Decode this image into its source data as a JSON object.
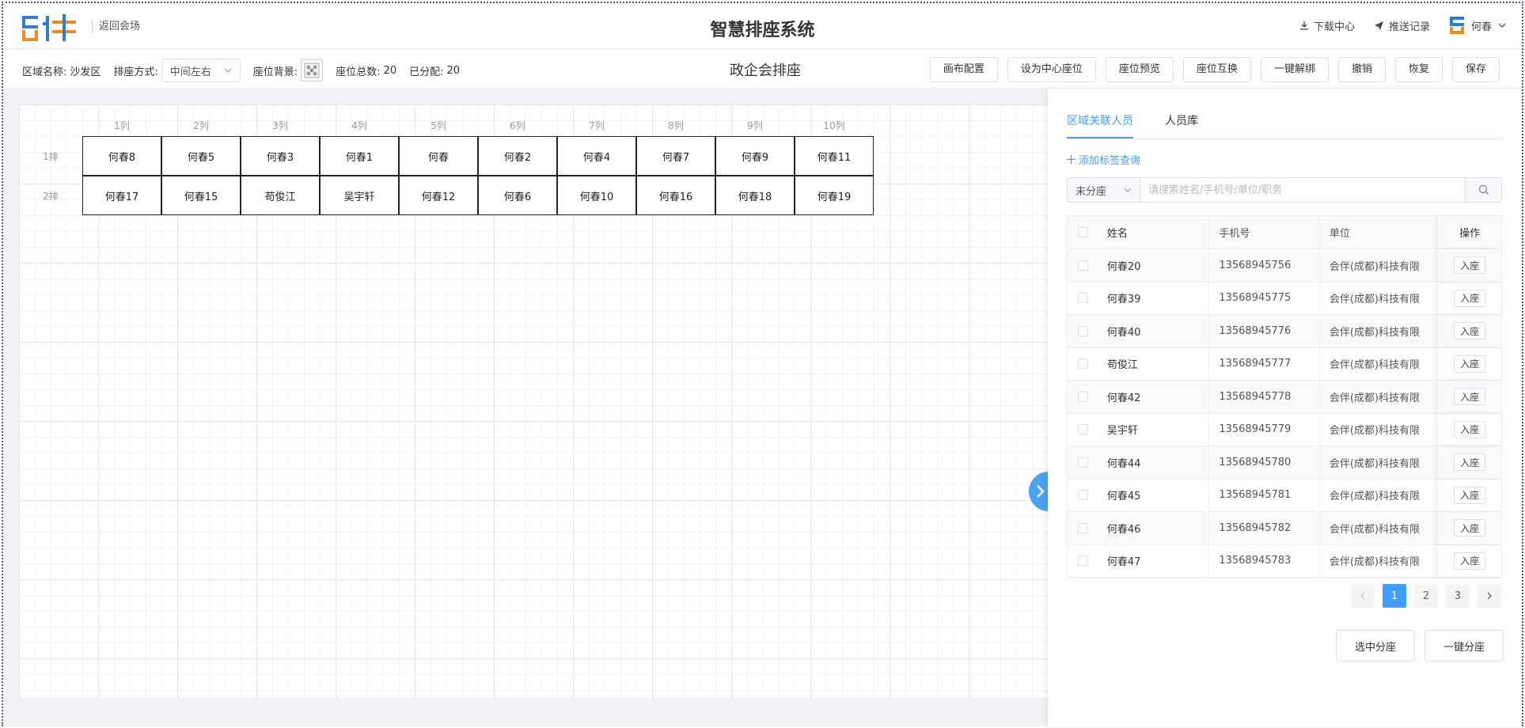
{
  "header": {
    "logo_text": "会伴",
    "back_label": "返回会场",
    "title": "智慧排座系统",
    "download_label": "下载中心",
    "push_label": "推送记录",
    "user_name": "何春"
  },
  "toolbar": {
    "area_label": "区域名称:",
    "area_value": "沙发区",
    "mode_label": "排座方式:",
    "mode_value": "中间左右",
    "bg_label": "座位背景:",
    "total_label": "座位总数:",
    "total_value": "20",
    "assigned_label": "已分配:",
    "assigned_value": "20",
    "center_title": "政企会排座",
    "buttons": [
      "画布配置",
      "设为中心座位",
      "座位预览",
      "座位互换",
      "一键解绑",
      "撤销",
      "恢复",
      "保存"
    ]
  },
  "canvas": {
    "columns": [
      "1列",
      "2列",
      "3列",
      "4列",
      "5列",
      "6列",
      "7列",
      "8列",
      "9列",
      "10列"
    ],
    "rows": [
      {
        "label": "1排",
        "seats": [
          "何春8",
          "何春5",
          "何春3",
          "何春1",
          "何春",
          "何春2",
          "何春4",
          "何春7",
          "何春9",
          "何春11"
        ]
      },
      {
        "label": "2排",
        "seats": [
          "何春17",
          "何春15",
          "苟俊江",
          "吴宇轩",
          "何春12",
          "何春6",
          "何春10",
          "何春16",
          "何春18",
          "何春19"
        ]
      }
    ]
  },
  "panel": {
    "tabs": [
      "区域关联人员",
      "人员库"
    ],
    "active_tab": 0,
    "add_tag_label": "添加标签查询",
    "filter_value": "未分座",
    "search_placeholder": "请搜索姓名/手机号/单位/职务",
    "table": {
      "headers": {
        "name": "姓名",
        "phone": "手机号",
        "unit": "单位",
        "op": "操作"
      },
      "rows": [
        {
          "name": "何春20",
          "phone": "13568945756",
          "unit": "会伴(成都)科技有限",
          "op": "入座"
        },
        {
          "name": "何春39",
          "phone": "13568945775",
          "unit": "会伴(成都)科技有限",
          "op": "入座"
        },
        {
          "name": "何春40",
          "phone": "13568945776",
          "unit": "会伴(成都)科技有限",
          "op": "入座"
        },
        {
          "name": "苟俊江",
          "phone": "13568945777",
          "unit": "会伴(成都)科技有限",
          "op": "入座"
        },
        {
          "name": "何春42",
          "phone": "13568945778",
          "unit": "会伴(成都)科技有限",
          "op": "入座"
        },
        {
          "name": "吴宇轩",
          "phone": "13568945779",
          "unit": "会伴(成都)科技有限",
          "op": "入座"
        },
        {
          "name": "何春44",
          "phone": "13568945780",
          "unit": "会伴(成都)科技有限",
          "op": "入座"
        },
        {
          "name": "何春45",
          "phone": "13568945781",
          "unit": "会伴(成都)科技有限",
          "op": "入座"
        },
        {
          "name": "何春46",
          "phone": "13568945782",
          "unit": "会伴(成都)科技有限",
          "op": "入座"
        },
        {
          "name": "何春47",
          "phone": "13568945783",
          "unit": "会伴(成都)科技有限",
          "op": "入座"
        }
      ]
    },
    "pagination": {
      "pages": [
        "1",
        "2",
        "3"
      ],
      "current": "1"
    },
    "bottom_buttons": [
      "选中分座",
      "一键分座"
    ]
  },
  "colors": {
    "accent": "#409eff",
    "logo_blue": "#2f7fd1",
    "logo_orange": "#f08a24",
    "toggle": "#4aa3f0"
  }
}
